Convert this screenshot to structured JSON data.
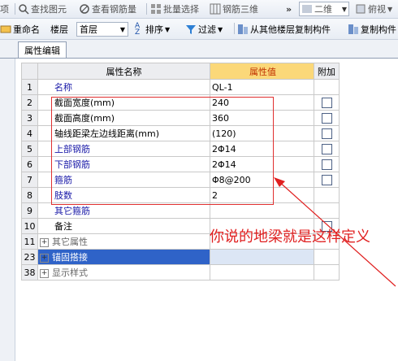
{
  "toolbar1": {
    "items": [
      {
        "label": "项",
        "icon": "cut-off-icon"
      },
      {
        "label": "查找图元",
        "icon": "find-element-icon"
      },
      {
        "label": "查看钢筋量",
        "icon": "view-rebar-icon"
      },
      {
        "label": "批量选择",
        "icon": "batch-select-icon"
      },
      {
        "label": "钢筋三维",
        "icon": "rebar-3d-icon"
      }
    ],
    "more_label": "»",
    "view_combo": "二维",
    "view_mode_label": "俯视"
  },
  "toolbar2": {
    "rename_label": "重命名",
    "floor_label": "楼层",
    "floor_value": "首层",
    "sort_label": "排序",
    "filter_label": "过滤",
    "copy_from_label": "从其他楼层复制构件",
    "copy_to_label": "复制构件"
  },
  "tab": {
    "label": "属性编辑"
  },
  "grid": {
    "headers": {
      "name": "属性名称",
      "value": "属性值",
      "extra": "附加"
    },
    "rows": [
      {
        "no": "1",
        "name": "名称",
        "value": "QL-1",
        "check": false,
        "color": "blue"
      },
      {
        "no": "2",
        "name": "截面宽度(mm)",
        "value": "240",
        "check": true,
        "color": "black"
      },
      {
        "no": "3",
        "name": "截面高度(mm)",
        "value": "360",
        "check": true,
        "color": "black"
      },
      {
        "no": "4",
        "name": "轴线距梁左边线距离(mm)",
        "value": "(120)",
        "check": true,
        "color": "black"
      },
      {
        "no": "5",
        "name": "上部钢筋",
        "value": "2Φ14",
        "check": true,
        "color": "blue"
      },
      {
        "no": "6",
        "name": "下部钢筋",
        "value": "2Φ14",
        "check": true,
        "color": "blue"
      },
      {
        "no": "7",
        "name": "箍筋",
        "value": "Φ8@200",
        "check": true,
        "color": "blue"
      },
      {
        "no": "8",
        "name": "肢数",
        "value": "2",
        "check": false,
        "color": "blue"
      },
      {
        "no": "9",
        "name": "其它箍筋",
        "value": "",
        "check": false,
        "color": "blue"
      },
      {
        "no": "10",
        "name": "备注",
        "value": "",
        "check": true,
        "color": "black"
      },
      {
        "no": "11",
        "name": "其它属性",
        "value": "",
        "check": false,
        "color": "gray",
        "group": true
      },
      {
        "no": "23",
        "name": "锚固搭接",
        "value": "",
        "check": false,
        "color": "white",
        "group": true,
        "selected": true
      },
      {
        "no": "38",
        "name": "显示样式",
        "value": "",
        "check": false,
        "color": "gray",
        "group": true
      }
    ]
  },
  "annotation": "你说的地梁就是这样定义"
}
